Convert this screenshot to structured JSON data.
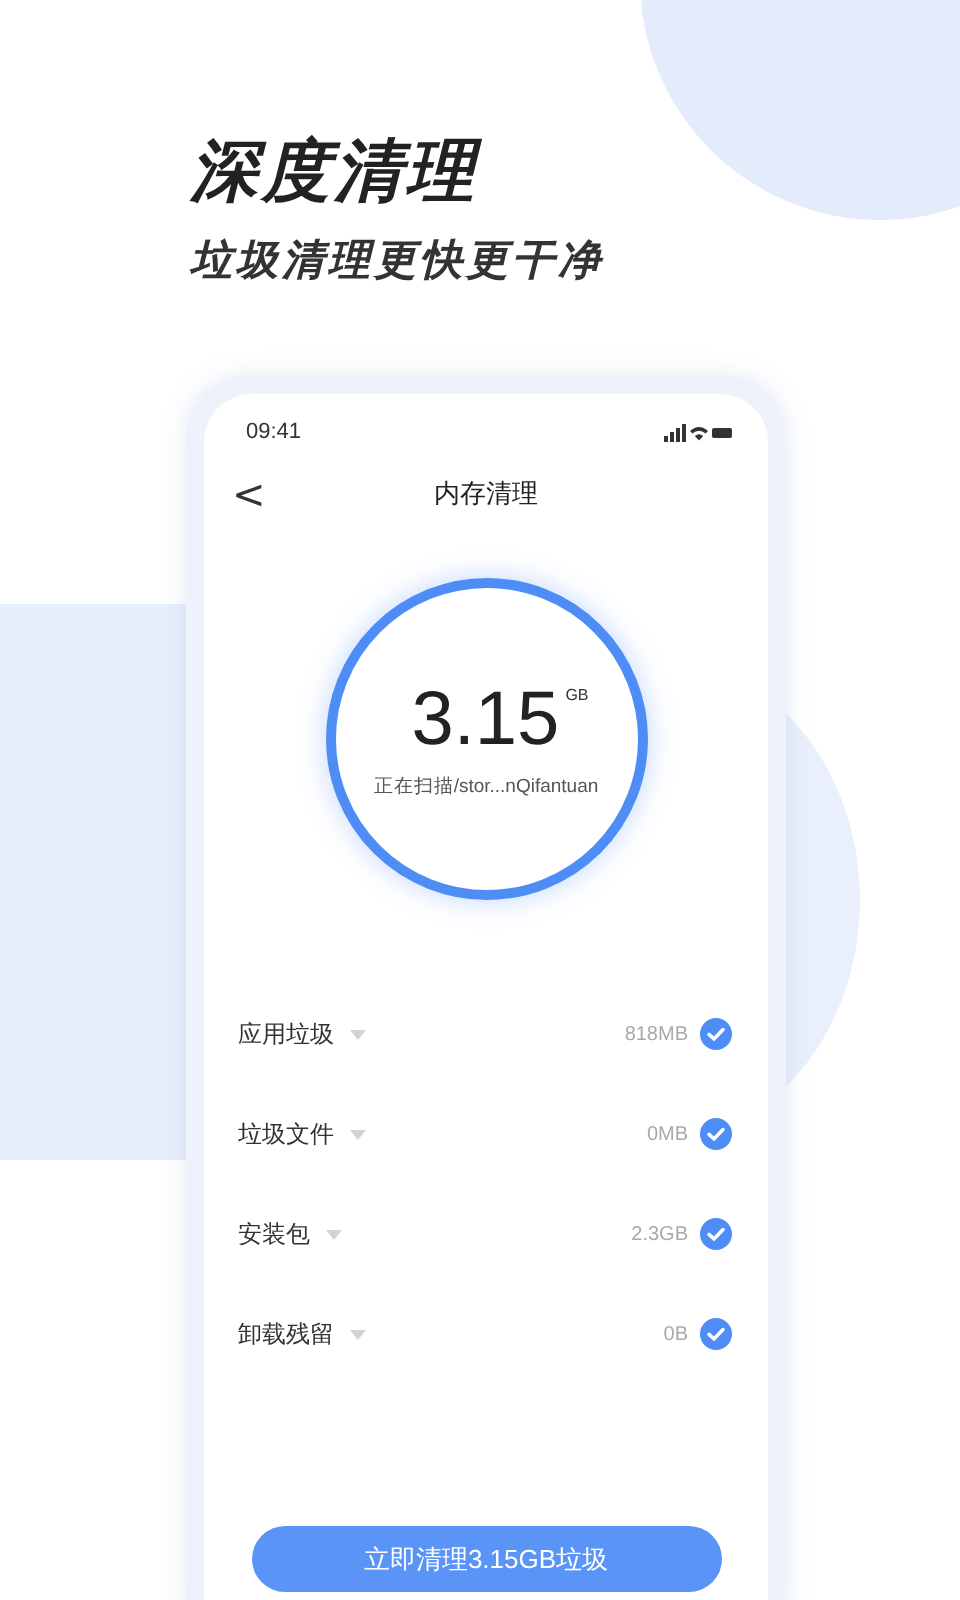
{
  "headline": "深度清理",
  "subheadline": "垃圾清理更快更干净",
  "status_bar": {
    "time": "09:41"
  },
  "nav": {
    "back": "<",
    "title": "内存清理"
  },
  "scan": {
    "amount": "3.15",
    "unit": "GB",
    "progress_text": "正在扫描/stor...nQifantuan"
  },
  "items": [
    {
      "label": "应用垃圾",
      "size": "818MB",
      "checked": true
    },
    {
      "label": "垃圾文件",
      "size": "0MB",
      "checked": true
    },
    {
      "label": "安装包",
      "size": "2.3GB",
      "checked": true
    },
    {
      "label": "卸载残留",
      "size": "0B",
      "checked": true
    }
  ],
  "clean_button": "立即清理3.15GB垃圾"
}
